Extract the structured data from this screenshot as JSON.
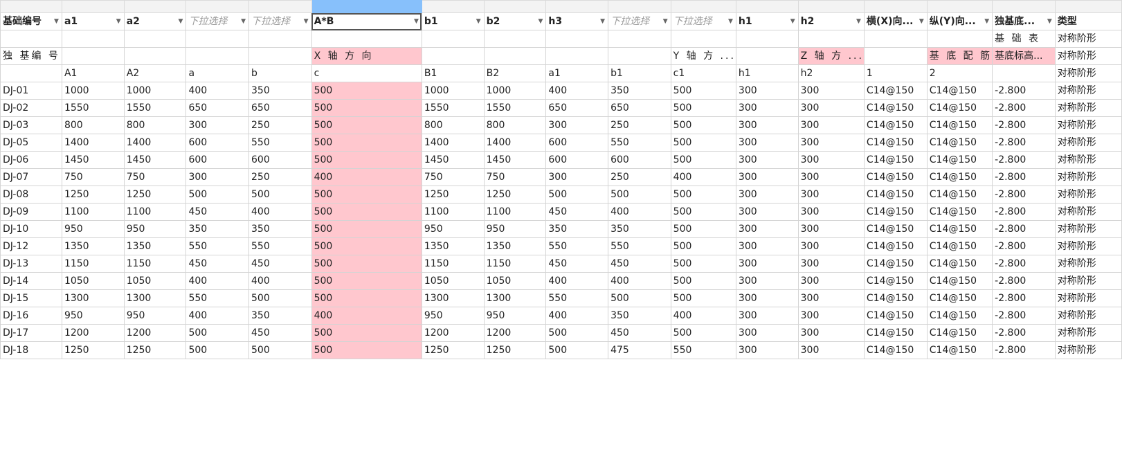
{
  "headers": [
    {
      "label": "基础编号",
      "type": "filter"
    },
    {
      "label": "a1",
      "type": "filter"
    },
    {
      "label": "a2",
      "type": "filter"
    },
    {
      "label": "下拉选择",
      "type": "placeholder"
    },
    {
      "label": "下拉选择",
      "type": "placeholder"
    },
    {
      "label": "A*B",
      "type": "filter",
      "active": true
    },
    {
      "label": "b1",
      "type": "filter"
    },
    {
      "label": "b2",
      "type": "filter"
    },
    {
      "label": "h3",
      "type": "filter"
    },
    {
      "label": "下拉选择",
      "type": "placeholder"
    },
    {
      "label": "下拉选择",
      "type": "placeholder"
    },
    {
      "label": "h1",
      "type": "filter"
    },
    {
      "label": "h2",
      "type": "filter"
    },
    {
      "label": "横(X)向...",
      "type": "filter"
    },
    {
      "label": "纵(Y)向...",
      "type": "filter"
    },
    {
      "label": "独基底...",
      "type": "filter"
    },
    {
      "label": "类型",
      "type": "plain"
    }
  ],
  "label_rows": [
    [
      "",
      "",
      "",
      "",
      "",
      "",
      "",
      "",
      "",
      "",
      "",
      "",
      "",
      "",
      "",
      "基 础 表",
      "对称阶形"
    ],
    [
      "独 基编 号",
      "",
      "",
      "",
      "",
      "X 轴 方 向",
      "",
      "",
      "",
      "",
      "Y 轴 方 ...",
      "",
      "Z 轴 方 ...",
      "",
      "基 底 配 筋",
      "基底标高...",
      "对称阶形"
    ],
    [
      "",
      "A1",
      "A2",
      "a",
      "b",
      "c",
      "B1",
      "B2",
      "a1",
      "b1",
      "c1",
      "h1",
      "h2",
      "1",
      "2",
      "",
      "对称阶形"
    ]
  ],
  "data_rows": [
    [
      "DJ-01",
      "1000",
      "1000",
      "400",
      "350",
      "500",
      "1000",
      "1000",
      "400",
      "350",
      "500",
      "300",
      "300",
      "C14@150",
      "C14@150",
      "-2.800",
      "对称阶形"
    ],
    [
      "DJ-02",
      "1550",
      "1550",
      "650",
      "650",
      "500",
      "1550",
      "1550",
      "650",
      "650",
      "500",
      "300",
      "300",
      "C14@150",
      "C14@150",
      "-2.800",
      "对称阶形"
    ],
    [
      "DJ-03",
      "800",
      "800",
      "300",
      "250",
      "500",
      "800",
      "800",
      "300",
      "250",
      "500",
      "300",
      "300",
      "C14@150",
      "C14@150",
      "-2.800",
      "对称阶形"
    ],
    [
      "DJ-05",
      "1400",
      "1400",
      "600",
      "550",
      "500",
      "1400",
      "1400",
      "600",
      "550",
      "500",
      "300",
      "300",
      "C14@150",
      "C14@150",
      "-2.800",
      "对称阶形"
    ],
    [
      "DJ-06",
      "1450",
      "1450",
      "600",
      "600",
      "500",
      "1450",
      "1450",
      "600",
      "600",
      "500",
      "300",
      "300",
      "C14@150",
      "C14@150",
      "-2.800",
      "对称阶形"
    ],
    [
      "DJ-07",
      "750",
      "750",
      "300",
      "250",
      "400",
      "750",
      "750",
      "300",
      "250",
      "400",
      "300",
      "300",
      "C14@150",
      "C14@150",
      "-2.800",
      "对称阶形"
    ],
    [
      "DJ-08",
      "1250",
      "1250",
      "500",
      "500",
      "500",
      "1250",
      "1250",
      "500",
      "500",
      "500",
      "300",
      "300",
      "C14@150",
      "C14@150",
      "-2.800",
      "对称阶形"
    ],
    [
      "DJ-09",
      "1100",
      "1100",
      "450",
      "400",
      "500",
      "1100",
      "1100",
      "450",
      "400",
      "500",
      "300",
      "300",
      "C14@150",
      "C14@150",
      "-2.800",
      "对称阶形"
    ],
    [
      "DJ-10",
      "950",
      "950",
      "350",
      "350",
      "500",
      "950",
      "950",
      "350",
      "350",
      "500",
      "300",
      "300",
      "C14@150",
      "C14@150",
      "-2.800",
      "对称阶形"
    ],
    [
      "DJ-12",
      "1350",
      "1350",
      "550",
      "550",
      "500",
      "1350",
      "1350",
      "550",
      "550",
      "500",
      "300",
      "300",
      "C14@150",
      "C14@150",
      "-2.800",
      "对称阶形"
    ],
    [
      "DJ-13",
      "1150",
      "1150",
      "450",
      "450",
      "500",
      "1150",
      "1150",
      "450",
      "450",
      "500",
      "300",
      "300",
      "C14@150",
      "C14@150",
      "-2.800",
      "对称阶形"
    ],
    [
      "DJ-14",
      "1050",
      "1050",
      "400",
      "400",
      "500",
      "1050",
      "1050",
      "400",
      "400",
      "500",
      "300",
      "300",
      "C14@150",
      "C14@150",
      "-2.800",
      "对称阶形"
    ],
    [
      "DJ-15",
      "1300",
      "1300",
      "550",
      "500",
      "500",
      "1300",
      "1300",
      "550",
      "500",
      "500",
      "300",
      "300",
      "C14@150",
      "C14@150",
      "-2.800",
      "对称阶形"
    ],
    [
      "DJ-16",
      "950",
      "950",
      "400",
      "350",
      "400",
      "950",
      "950",
      "400",
      "350",
      "400",
      "300",
      "300",
      "C14@150",
      "C14@150",
      "-2.800",
      "对称阶形"
    ],
    [
      "DJ-17",
      "1200",
      "1200",
      "500",
      "450",
      "500",
      "1200",
      "1200",
      "500",
      "450",
      "500",
      "300",
      "300",
      "C14@150",
      "C14@150",
      "-2.800",
      "对称阶形"
    ],
    [
      "DJ-18",
      "1250",
      "1250",
      "500",
      "500",
      "500",
      "1250",
      "1250",
      "500",
      "475",
      "550",
      "300",
      "300",
      "C14@150",
      "C14@150",
      "-2.800",
      "对称阶形"
    ]
  ],
  "colors": {
    "highlight": "#ffc7ce",
    "selected_header": "#87c0fb"
  }
}
